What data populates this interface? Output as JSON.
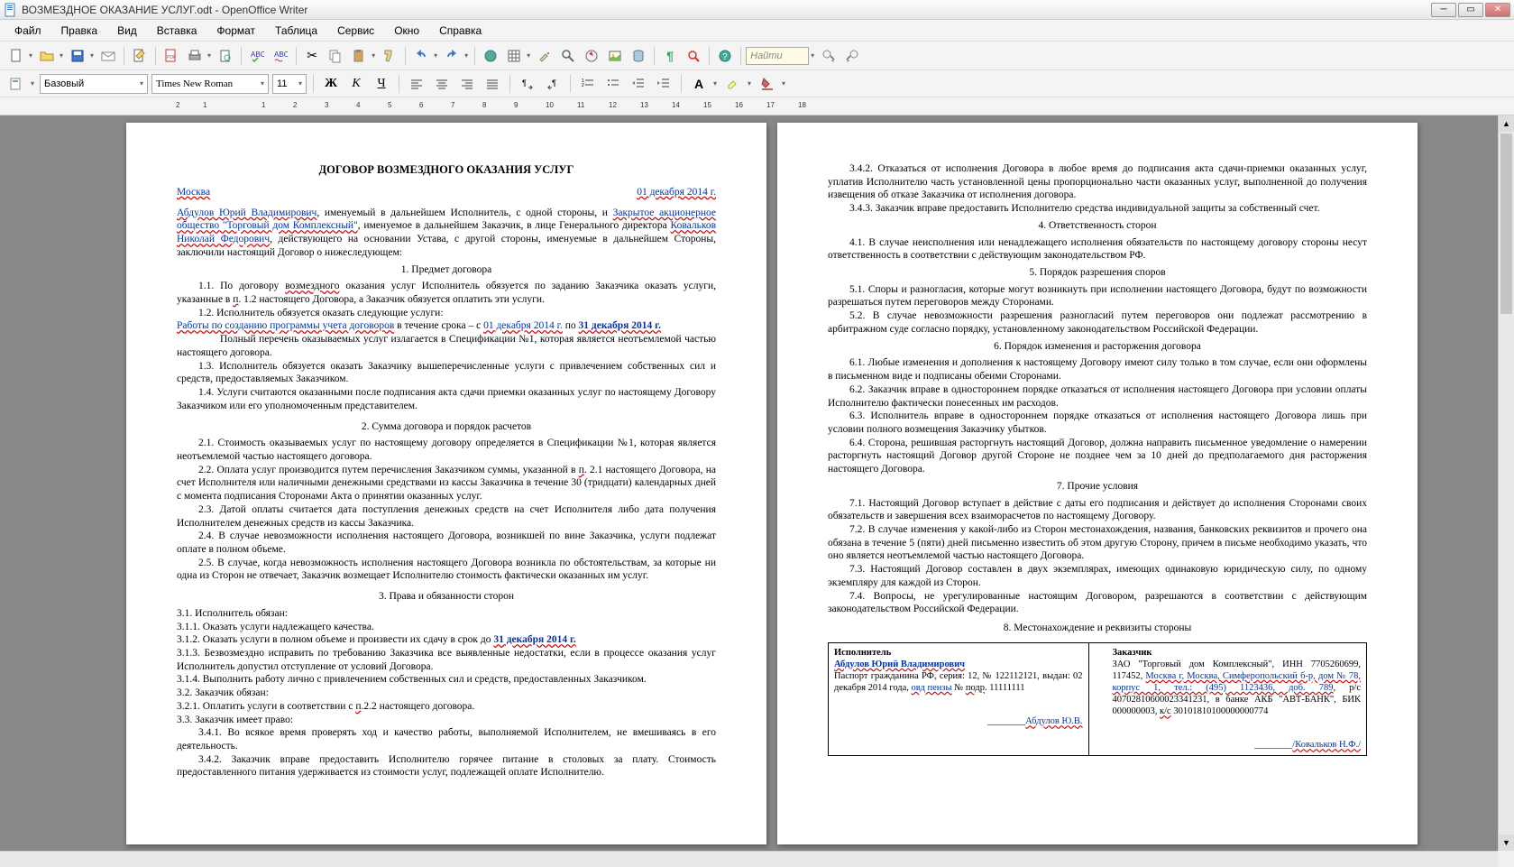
{
  "window": {
    "title": "ВОЗМЕЗДНОЕ ОКАЗАНИЕ УСЛУГ.odt - OpenOffice Writer"
  },
  "menu": {
    "file": "Файл",
    "edit": "Правка",
    "view": "Вид",
    "insert": "Вставка",
    "format": "Формат",
    "table": "Таблица",
    "tools": "Сервис",
    "window": "Окно",
    "help": "Справка"
  },
  "format_bar": {
    "style": "Базовый",
    "font": "Times New Roman",
    "size": "11"
  },
  "find": {
    "placeholder": "Найти"
  },
  "doc": {
    "title": "ДОГОВОР ВОЗМЕЗДНОГО ОКАЗАНИЯ УСЛУГ",
    "city": "Москва",
    "date": "01 декабря 2014 г.",
    "party1_name": "Абдулов Юрий Владимирович",
    "intro1": ", именуемый в дальнейшем Исполнитель, с одной стороны, и ",
    "party2_name": "Закрытое акционерное общество \"Торговый дом Комплексный\"",
    "intro2": ", именуемое в дальнейшем Заказчик, в лице Генерального директора ",
    "director": "Ковальков Николай Федорович",
    "intro3": ", действующего на основании Устава, с другой стороны, именуемые в дальнейшем Стороны, заключили настоящий Договор о нижеследующем:",
    "h1": "1. Предмет договора",
    "p1_1a": "1.1. По договору ",
    "p1_1b": "возмездного",
    "p1_1c": " оказания услуг Исполнитель обязуется по заданию Заказчика оказать услуги, указанные в ",
    "p1_1d": "п",
    "p1_1e": ". 1.2 настоящего Договора, а Заказчик обязуется оплатить эти услуги.",
    "p1_2a": "1.2. Исполнитель обязуется оказать следующие услуги:",
    "p1_2b": "Работы по созданию программы учета договоров",
    "p1_2c": " в течение срока – с ",
    "p1_2d": "01 декабря 2014 г.",
    "p1_2e": " по ",
    "p1_2f": "31 декабря 2014 г.",
    "p1_2g": "Полный перечень оказываемых услуг излагается в Спецификации №1, которая является неотъемлемой частью настоящего договора.",
    "p1_3": "1.3. Исполнитель обязуется оказать Заказчику вышеперечисленные услуги с привлечением собственных сил и средств, предоставляемых Заказчиком.",
    "p1_4": "1.4. Услуги считаются оказанными после подписания акта сдачи приемки оказанных услуг по настоящему Договору Заказчиком или его уполномоченным представителем.",
    "h2": "2. Сумма договора и порядок расчетов",
    "p2_1": "2.1. Стоимость оказываемых услуг по настоящему договору определяется в Спецификации №1, которая является неотъемлемой частью настоящего договора.",
    "p2_2a": "2.2. Оплата услуг производится путем перечисления Заказчиком суммы, указанной в ",
    "p2_2b": "п",
    "p2_2c": ". 2.1 настоящего Договора, на счет Исполнителя или наличными денежными средствами из кассы Заказчика в течение 30 (тридцати) календарных дней с момента подписания Сторонами Акта о принятии оказанных услуг.",
    "p2_3": "2.3. Датой оплаты считается дата поступления денежных средств на счет Исполнителя либо дата получения Исполнителем денежных средств из кассы Заказчика.",
    "p2_4": "2.4. В случае невозможности исполнения настоящего Договора, возникшей по вине Заказчика, услуги подлежат оплате в полном объеме.",
    "p2_5": "2.5. В случае, когда невозможность исполнения настоящего Договора возникла по обстоятельствам, за которые ни одна из Сторон не отвечает, Заказчик возмещает Исполнителю стоимость фактически оказанных им услуг.",
    "h3": "3. Права и обязанности сторон",
    "p3_1": "3.1. Исполнитель обязан:",
    "p3_1_1": "3.1.1. Оказать услуги надлежащего качества.",
    "p3_1_2a": "3.1.2. Оказать услуги в полном объеме и произвести их сдачу в срок до ",
    "p3_1_2b": "31 декабря 2014 г.",
    "p3_1_3": "3.1.3. Безвозмездно исправить по требованию Заказчика все выявленные недостатки, если в процессе оказания услуг Исполнитель допустил отступление от условий Договора.",
    "p3_1_4": "3.1.4. Выполнить работу лично с привлечением собственных сил и средств, предоставленных Заказчиком.",
    "p3_2": "3.2. Заказчик обязан:",
    "p3_2_1a": "3.2.1. Оплатить услуги в соответствии с ",
    "p3_2_1b": "п",
    "p3_2_1c": ".2.2 настоящего договора.",
    "p3_3": "3.3. Заказчик имеет право:",
    "p3_4_1": "3.4.1. Во всякое время проверять ход и качество работы, выполняемой Исполнителем, не вмешиваясь в его деятельность.",
    "p3_4_2": "3.4.2. Заказчик вправе предоставить Исполнителю горячее питание в столовых за плату. Стоимость предоставленного питания удерживается из стоимости услуг, подлежащей оплате Исполнителю.",
    "p3_4_2b": "3.4.2. Отказаться от исполнения Договора в любое время до подписания акта сдачи-приемки оказанных услуг, уплатив Исполнителю часть установленной цены пропорционально части оказанных услуг, выполненной до получения извещения об отказе Заказчика от исполнения договора.",
    "p3_4_3": "3.4.3. Заказчик вправе предоставить Исполнителю средства индивидуальной защиты за собственный счет.",
    "h4": "4. Ответственность сторон",
    "p4_1": "4.1. В случае неисполнения или ненадлежащего исполнения обязательств по настоящему договору стороны несут ответственность в соответствии с действующим законодательством РФ.",
    "h5": "5. Порядок разрешения споров",
    "p5_1": "5.1. Споры и разногласия, которые могут возникнуть при исполнении настоящего Договора, будут по возможности разрешаться путем переговоров между Сторонами.",
    "p5_2": "5.2. В случае невозможности разрешения разногласий путем переговоров они подлежат рассмотрению в арбитражном суде согласно порядку, установленному законодательством Российской Федерации.",
    "h6": "6. Порядок изменения и расторжения договора",
    "p6_1": "6.1. Любые изменения и дополнения к настоящему Договору имеют силу только в том случае, если они оформлены в письменном виде и подписаны обеими Сторонами.",
    "p6_2": "6.2. Заказчик вправе в одностороннем порядке отказаться от исполнения настоящего Договора при условии оплаты Исполнителю фактически понесенных им расходов.",
    "p6_3": "6.3. Исполнитель вправе в одностороннем порядке отказаться от исполнения настоящего Договора лишь при условии полного возмещения Заказчику убытков.",
    "p6_4": "6.4. Сторона, решившая расторгнуть настоящий Договор, должна направить письменное уведомление о намерении расторгнуть настоящий Договор другой Стороне не позднее чем за 10 дней до предполагаемого дня расторжения настоящего Договора.",
    "h7": "7. Прочие условия",
    "p7_1": "7.1. Настоящий Договор вступает в действие с даты его подписания и действует до исполнения Сторонами своих обязательств и завершения всех взаиморасчетов по настоящему Договору.",
    "p7_2": "7.2. В случае изменения у какой-либо из Сторон местонахождения, названия, банковских реквизитов и прочего она обязана в течение 5 (пяти) дней письменно известить об этом другую Сторону, причем в письме необходимо указать, что оно является неотъемлемой частью настоящего Договора.",
    "p7_3": "7.3. Настоящий Договор составлен в двух экземплярах, имеющих одинаковую юридическую силу, по одному экземпляру для каждой из Сторон.",
    "p7_4": "7.4. Вопросы, не урегулированные настоящим Договором, разрешаются в соответствии с действующим законодательством Российской Федерации.",
    "h8": "8. Местонахождение и реквизиты стороны",
    "sig": {
      "left_head": "Исполнитель",
      "left_name": "Абдулов Юрий Владимирович",
      "left_body1": "Паспорт гражданина РФ, серия: 12, № 122112121, выдан: 02 декабря 2014 года, ",
      "left_body_ovd": "овд пензы",
      "left_body2": " № ",
      "left_body_podr": "подр",
      "left_body3": ". 11111111",
      "left_sign": "Абдулов Ю.В.",
      "right_head": "Заказчик",
      "right_body": "ЗАО \"Торговый дом Комплексный\", ИНН 7705260699, 117452, ",
      "right_addr": "Москва г, Москва, Симферопольский б-р, дом № 78, корпус 1, тел.: (495) 1123436, доб. 789",
      "right_body2": ", р/с 40702810600023341231, в банке АКБ \"АВТ-БАНК\", БИК 000000003, ",
      "right_ks": "к/с",
      "right_body3": " 30101810100000000774",
      "right_sign": "/Ковальков Н.Ф./"
    }
  }
}
